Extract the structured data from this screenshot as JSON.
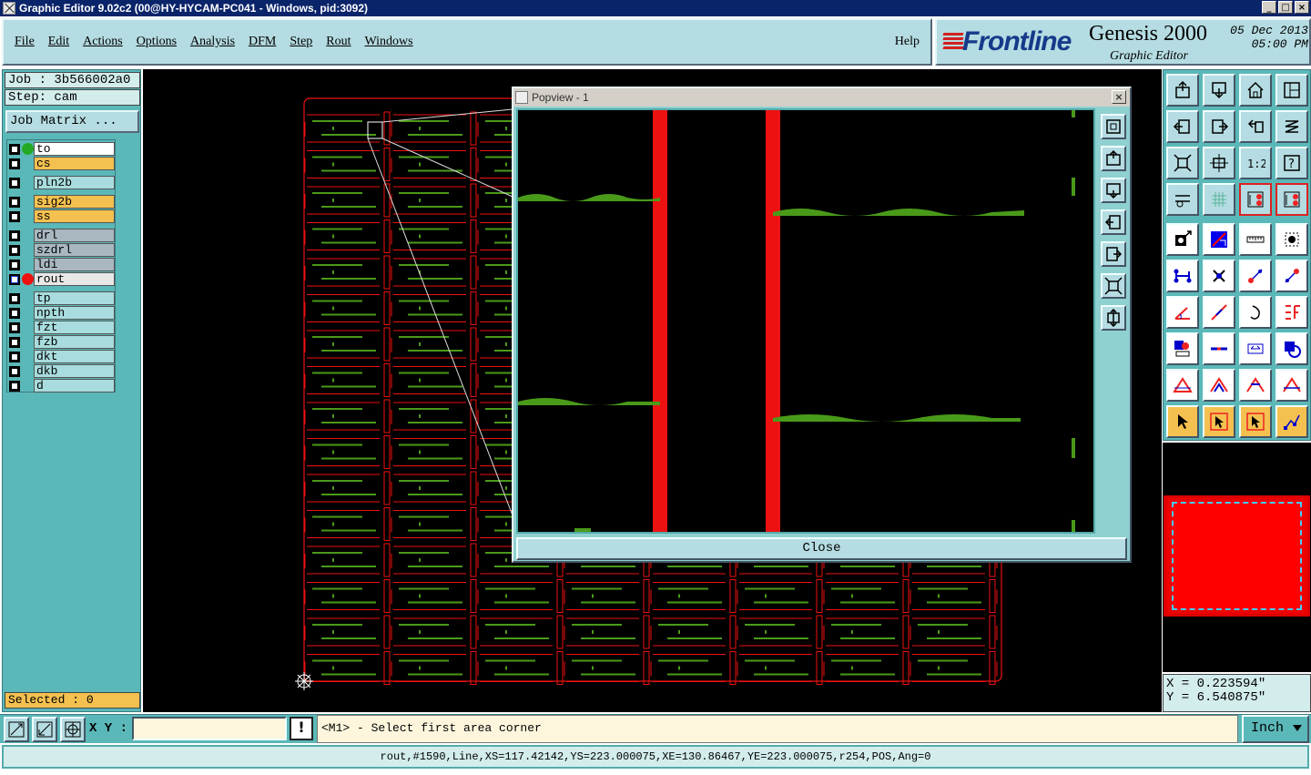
{
  "window": {
    "title": "Graphic Editor 9.02c2 (00@HY-HYCAM-PC041 - Windows, pid:3092)",
    "min_label": "_",
    "max_label": "□",
    "close_label": "×"
  },
  "menu": {
    "items": [
      "File",
      "Edit",
      "Actions",
      "Options",
      "Analysis",
      "DFM",
      "Step",
      "Rout",
      "Windows"
    ],
    "help": "Help"
  },
  "logo": {
    "brand": "Frontline",
    "product": "Genesis 2000",
    "subtitle": "Graphic Editor",
    "date": "05 Dec 2013",
    "time": "05:00 PM"
  },
  "job": {
    "job_label": "Job : 3b566002a0",
    "step_label": "Step: cam",
    "matrix_button": "Job Matrix ..."
  },
  "layers": [
    {
      "name": "to",
      "color": "#ffffff",
      "dot": "#22aa22"
    },
    {
      "name": "cs",
      "color": "#f4c150",
      "dot": null
    },
    {
      "name": "pln2b",
      "color": "#a8dcde",
      "dot": null
    },
    {
      "name": "sig2b",
      "color": "#f4c150",
      "dot": null
    },
    {
      "name": "ss",
      "color": "#f4c150",
      "dot": null
    },
    {
      "name": "drl",
      "color": "#a9b8c0",
      "dot": null
    },
    {
      "name": "szdrl",
      "color": "#a9b8c0",
      "dot": null
    },
    {
      "name": "ldi",
      "color": "#a9b8c0",
      "dot": null
    },
    {
      "name": "rout",
      "color": "#e8e8e8",
      "dot": "#ee1111"
    },
    {
      "name": "tp",
      "color": "#a8dcde",
      "dot": null
    },
    {
      "name": "npth",
      "color": "#a8dcde",
      "dot": null
    },
    {
      "name": "fzt",
      "color": "#a8dcde",
      "dot": null
    },
    {
      "name": "fzb",
      "color": "#a8dcde",
      "dot": null
    },
    {
      "name": "dkt",
      "color": "#a8dcde",
      "dot": null
    },
    {
      "name": "dkb",
      "color": "#a8dcde",
      "dot": null
    },
    {
      "name": "d",
      "color": "#a8dcde",
      "dot": null
    }
  ],
  "selected_label": "Selected : 0",
  "popview": {
    "title": "Popview - 1",
    "close_label": "Close"
  },
  "coords": {
    "x": "X = 0.223594\"",
    "y": "Y = 6.540875\""
  },
  "bottom": {
    "xy_label": "X Y :",
    "xy_value": "",
    "excl": "!",
    "prompt": "<M1> - Select first area corner",
    "unit": "Inch"
  },
  "status_text": "rout,#1590,Line,XS=117.42142,YS=223.000075,XE=130.86467,YE=223.000075,r254,POS,Ang=0",
  "colors": {
    "rout": "#ee1111",
    "signal": "#4a9a1a",
    "panel": "#5bb8b8",
    "button": "#b5dce2"
  },
  "right_tools": [
    "zoom-home-icon",
    "zoom-in-icon",
    "home-icon",
    "split-view-icon",
    "pan-left-icon",
    "pan-right-icon",
    "undo-zoom-icon",
    "redraw-icon",
    "fit-icon",
    "center-icon",
    "scale-1to2-icon",
    "query-icon",
    "snap-icon",
    "grid-icon",
    "layer-red-icon",
    "layer-red2-icon",
    "add-pad-icon",
    "add-line-icon",
    "measure-icon",
    "select-box-icon",
    "move-icon",
    "delete-icon",
    "connect-icon",
    "route-icon",
    "angle-icon",
    "line-cut-icon",
    "arc-icon",
    "text-icon",
    "merge-icon",
    "cut-icon",
    "dimension-icon",
    "copy-icon",
    "triangle-icon",
    "triangle-sel-icon",
    "triangle-area-icon",
    "triangle-line-icon",
    "cursor-icon",
    "cursor-box-icon",
    "cursor-box2-icon",
    "snap-point-icon"
  ]
}
